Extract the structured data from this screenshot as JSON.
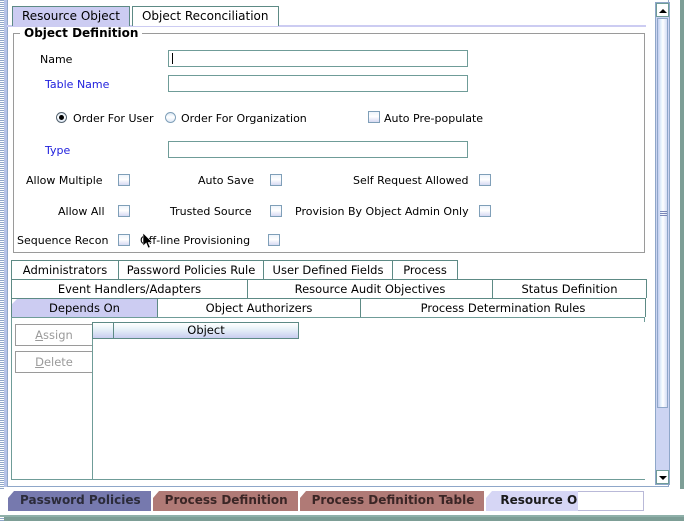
{
  "window": {
    "top_tabs": [
      {
        "label": "Resource Object",
        "selected": true
      },
      {
        "label": "Object Reconciliation",
        "selected": false
      }
    ]
  },
  "object_definition": {
    "title": "Object Definition",
    "fields": [
      {
        "label": "Name",
        "value": "",
        "blue": false
      },
      {
        "label": "Table Name",
        "value": "",
        "blue": true
      },
      {
        "label": "Type",
        "value": "",
        "blue": true
      }
    ],
    "radios": [
      {
        "label": "Order For User",
        "selected": true
      },
      {
        "label": "Order For Organization",
        "selected": false
      }
    ],
    "checkboxes": [
      {
        "label": "Auto Pre-populate",
        "checked": false
      },
      {
        "label": "Allow Multiple",
        "checked": false
      },
      {
        "label": "Auto Save",
        "checked": false
      },
      {
        "label": "Self Request Allowed",
        "checked": false
      },
      {
        "label": "Allow All",
        "checked": false
      },
      {
        "label": "Trusted Source",
        "checked": false
      },
      {
        "label": "Provision By Object Admin Only",
        "checked": false
      },
      {
        "label": "Sequence Recon",
        "checked": false
      },
      {
        "label": "Off-line Provisioning",
        "checked": false
      }
    ]
  },
  "mid_tabs": {
    "row1": [
      {
        "label": "Administrators",
        "selected": false
      },
      {
        "label": "Password Policies Rule",
        "selected": false
      },
      {
        "label": "User Defined Fields",
        "selected": false
      },
      {
        "label": "Process",
        "selected": false
      }
    ],
    "row2": [
      {
        "label": "Event Handlers/Adapters",
        "selected": false
      },
      {
        "label": "Resource Audit Objectives",
        "selected": false
      },
      {
        "label": "Status Definition",
        "selected": false
      }
    ],
    "row3": [
      {
        "label": "Depends On",
        "selected": true
      },
      {
        "label": "Object Authorizers",
        "selected": false
      },
      {
        "label": "Process Determination Rules",
        "selected": false
      }
    ]
  },
  "depends_on_panel": {
    "buttons": [
      {
        "label": "Assign",
        "mnemonic": "A",
        "enabled": false
      },
      {
        "label": "Delete",
        "mnemonic": "D",
        "enabled": false
      }
    ],
    "table": {
      "columns": [
        "",
        "Object"
      ],
      "rows": []
    }
  },
  "scrollbar": {
    "up_icon": "triangle-up-icon",
    "down_icon": "triangle-down-icon"
  },
  "taskbar": {
    "tabs": [
      {
        "label": "Password Policies",
        "style": "purple",
        "active": false
      },
      {
        "label": "Process Definition",
        "style": "brown",
        "active": false
      },
      {
        "label": "Process Definition Table",
        "style": "brown",
        "active": false
      },
      {
        "label": "Resource Objects",
        "style": "active",
        "active": true
      }
    ]
  },
  "colors": {
    "selected_tab": "#ccccf2",
    "tab_border": "#5d8a85",
    "field_border": "#6f9c98",
    "label_blue": "#2020dd",
    "taskbar_purple": "#7679ae",
    "taskbar_brown": "#b07a76",
    "taskbar_active": "#d6d6f5",
    "frame_green": "#7d9e96"
  }
}
